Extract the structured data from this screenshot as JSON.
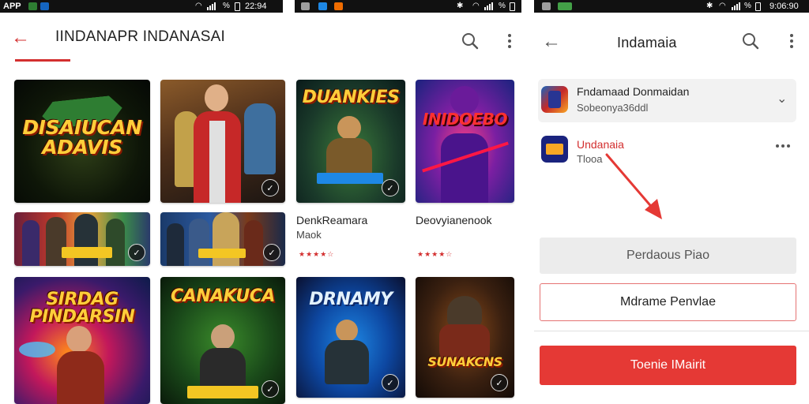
{
  "status_bars": [
    {
      "left_text": "APP",
      "time": "22:94"
    },
    {
      "left_text": "",
      "time": ""
    },
    {
      "left_text": "",
      "time": "9:06:90"
    }
  ],
  "colors": {
    "accent": "#d32f2f",
    "primary_button": "#e53935",
    "dim_button": "#ececec",
    "ink": "#222222"
  },
  "left_screen": {
    "title": "IINDANAPR INDANASAI",
    "back_icon": "back-arrow-icon",
    "search_icon": "search-icon",
    "more_icon": "more-vert-icon",
    "tiles": [
      {
        "title": "DISAIUCAN ADAVIS"
      },
      {
        "title": ""
      },
      {
        "title": ""
      },
      {
        "title": ""
      },
      {
        "title": "SIRDAG PINDARSIN"
      },
      {
        "title": "CANAKUCA"
      }
    ]
  },
  "middle_screen": {
    "tiles": [
      {
        "title": "DUANKIES"
      },
      {
        "title": "INIDOEBO"
      },
      {
        "title": "DRNAMY"
      },
      {
        "title": "SUNAKCNS"
      }
    ],
    "games": [
      {
        "name": "DenkReamara",
        "subtitle": "Maok",
        "rating": "★★★★☆"
      },
      {
        "name": "Deovyianenook",
        "subtitle": "",
        "rating": "★★★★☆"
      }
    ]
  },
  "right_screen": {
    "title": "Indamaia",
    "items": [
      {
        "title": "Fndamaad Donmaidan",
        "subtitle": "Sobeonya36ddl",
        "action_icon": "chevron-down-icon"
      },
      {
        "title": "Undanaia",
        "subtitle": "Tlooa",
        "action_icon": "more-horiz-icon"
      }
    ],
    "buttons": {
      "secondary": "Perdaous Piao",
      "outline": "Mdrame Penvlae",
      "primary": "Toenie IMairit"
    }
  }
}
